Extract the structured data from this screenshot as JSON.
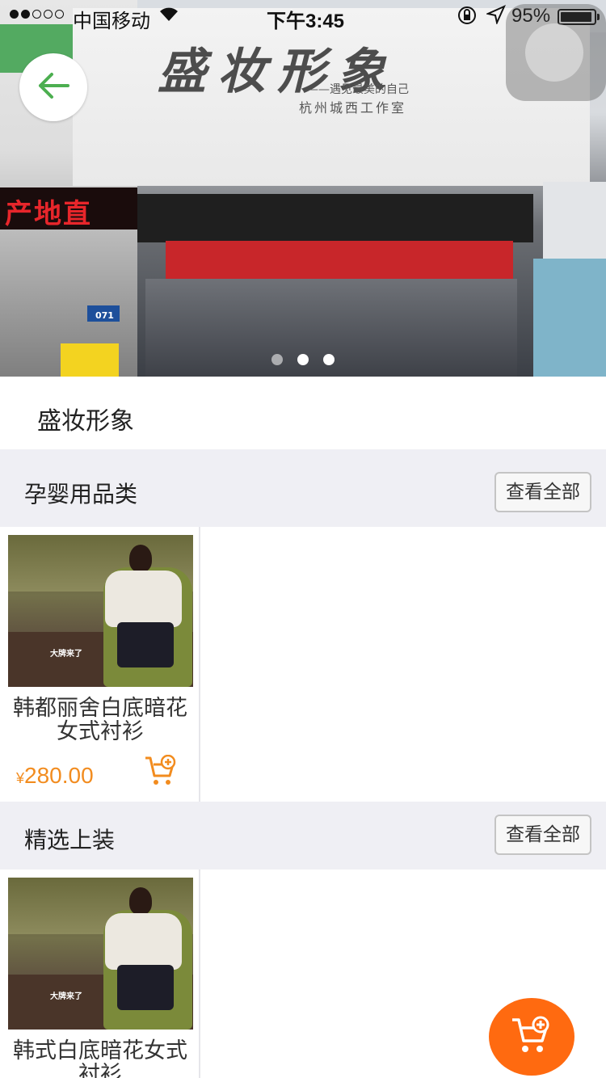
{
  "status_bar": {
    "carrier": "中国移动",
    "time": "下午3:45",
    "battery": "95%"
  },
  "hero": {
    "carousel_count": 3,
    "active_index": 1,
    "sign_text": "盛妆形象",
    "sign_subtitle": "——遇见最美的自己",
    "sign_subtitle2": "杭州城西工作室",
    "led_text": "产地直",
    "plate_text": "071"
  },
  "store": {
    "name": "盛妆形象"
  },
  "sections": [
    {
      "title": "孕婴用品类",
      "view_all": "查看全部",
      "products": [
        {
          "name": "韩都丽舍白底暗花女式衬衫",
          "currency": "¥",
          "price": "280.00",
          "image_caption": "大牌来了"
        }
      ]
    },
    {
      "title": "精选上装",
      "view_all": "查看全部",
      "products": [
        {
          "name": "韩式白底暗花女式衬衫",
          "image_caption": "大牌来了"
        }
      ]
    }
  ],
  "icons": {
    "back": "arrow-left-icon",
    "add_to_cart": "cart-plus-icon",
    "fab": "cart-plus-icon"
  },
  "colors": {
    "accent": "#ff6a10",
    "price": "#f28c1f",
    "back_arrow": "#4caf50"
  }
}
